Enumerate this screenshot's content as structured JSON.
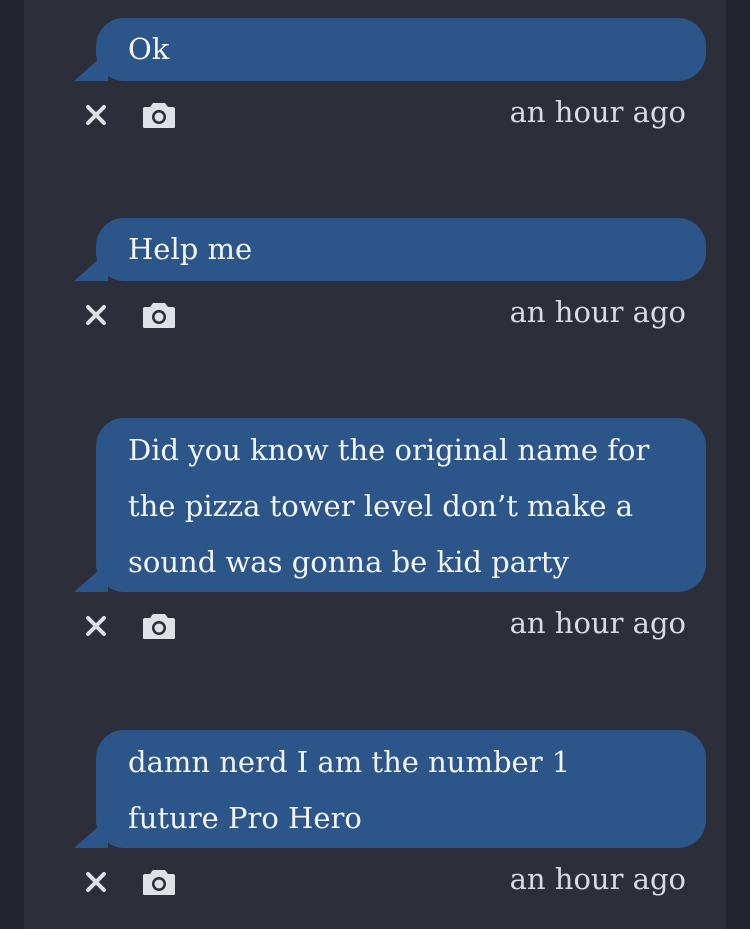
{
  "colors": {
    "page_background": "#222530",
    "column_background": "#2c2e39",
    "bubble": "#2c5589",
    "bubble_text": "#f2f4f8",
    "meta_text": "#d8dbe2",
    "icon": "#dfe1e6"
  },
  "messages": [
    {
      "lines": [
        "Ok"
      ],
      "timestamp": "an hour ago",
      "actions": [
        "close-icon",
        "camera-icon"
      ]
    },
    {
      "lines": [
        "Help me"
      ],
      "timestamp": "an hour ago",
      "actions": [
        "close-icon",
        "camera-icon"
      ]
    },
    {
      "lines": [
        "Did you know the original name for",
        "the pizza tower level don’t make a",
        "sound was gonna be kid party"
      ],
      "timestamp": "an hour ago",
      "actions": [
        "close-icon",
        "camera-icon"
      ]
    },
    {
      "lines": [
        "damn nerd I am the number 1",
        "future Pro Hero"
      ],
      "timestamp": "an hour ago",
      "actions": [
        "close-icon",
        "camera-icon"
      ]
    }
  ]
}
